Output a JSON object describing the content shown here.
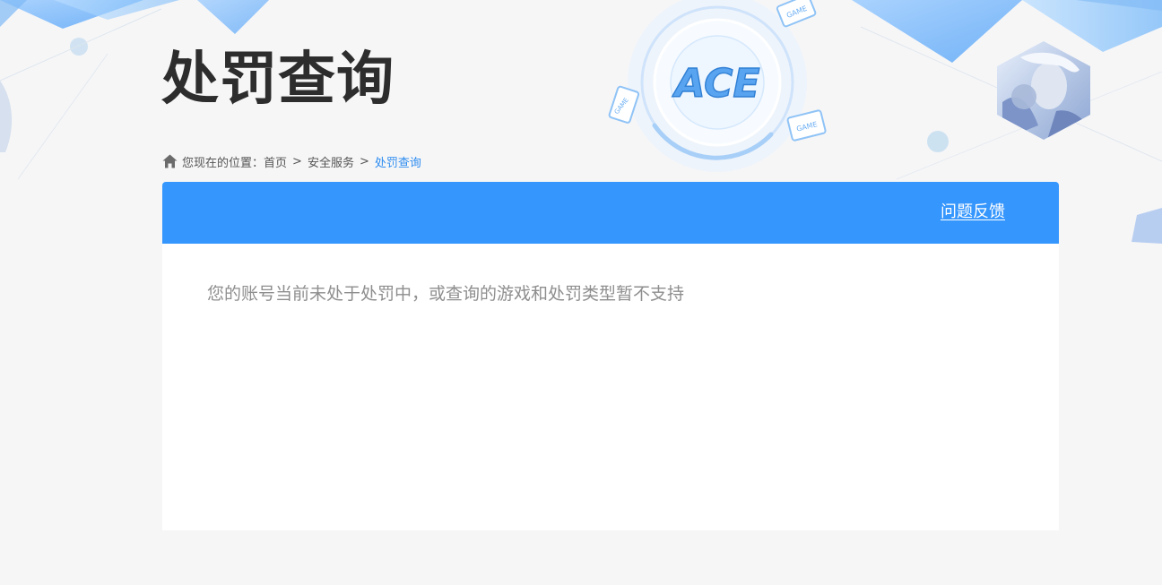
{
  "page": {
    "title": "处罚查询"
  },
  "breadcrumb": {
    "prefix": "您现在的位置：",
    "items": [
      "首页",
      "安全服务"
    ],
    "current": "处罚查询",
    "separator": ">"
  },
  "panel": {
    "feedback_label": "问题反馈",
    "message": "您的账号当前未处于处罚中，或查询的游戏和处罚类型暂不支持"
  },
  "logo": {
    "text": "ACE",
    "badge_text": "GAME"
  },
  "colors": {
    "accent": "#3596fd",
    "link": "#2d8cf0",
    "title": "#2d2d2d",
    "message": "#8e8e8e",
    "background": "#f6f6f7"
  },
  "icons": {
    "breadcrumb": "home-icon",
    "banner": [
      "ace-logo-icon",
      "game-badge-icon",
      "character-avatar-icon"
    ]
  }
}
